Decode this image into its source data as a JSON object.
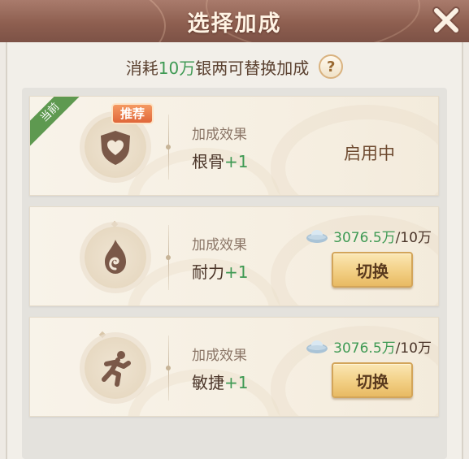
{
  "dialog": {
    "title": "选择加成"
  },
  "cost_line": {
    "prefix": "消耗",
    "amount": "10万",
    "currency": "银两",
    "suffix": "可替换加成"
  },
  "help_label": "?",
  "effect_label": "加成效果",
  "cards": [
    {
      "icon": "heart-shield-icon",
      "current_tag": "当前",
      "recommend_tag": "推荐",
      "stat": "根骨",
      "bonus": "+1",
      "status": "启用中"
    },
    {
      "icon": "flame-icon",
      "stat": "耐力",
      "bonus": "+1",
      "owned": "3076.5万",
      "required": "/10万",
      "button_label": "切换"
    },
    {
      "icon": "running-figure-icon",
      "stat": "敏捷",
      "bonus": "+1",
      "owned": "3076.5万",
      "required": "/10万",
      "button_label": "切换"
    }
  ],
  "colors": {
    "header": "#8e5f50",
    "highlight_green": "#3f9a54",
    "button_gold": "#f2cf84",
    "ribbon_green": "#5e9950",
    "badge_orange": "#e0663a"
  }
}
